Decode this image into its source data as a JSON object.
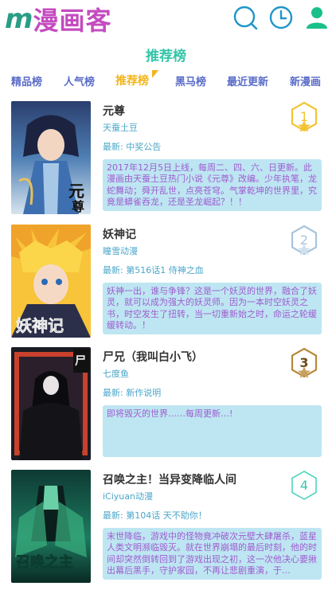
{
  "app": {
    "logo_m": "m",
    "logo_text": "漫画客"
  },
  "header": {
    "icons": [
      "search-icon",
      "clock-icon",
      "user-icon"
    ]
  },
  "section_title": "推荐榜",
  "tabs": [
    {
      "label": "精品榜",
      "active": false
    },
    {
      "label": "人气榜",
      "active": false
    },
    {
      "label": "推荐榜",
      "active": true
    },
    {
      "label": "黑马榜",
      "active": false
    },
    {
      "label": "最近更新",
      "active": false
    },
    {
      "label": "新漫画",
      "active": false
    }
  ],
  "latest_prefix": "最新: ",
  "items": [
    {
      "rank": "1",
      "title": "元尊",
      "author": "天蚕土豆",
      "latest": "中奖公告",
      "desc": "2017年12月5日上线，每周二、四、六、日更新。此漫画由天蚕土豆热门小说《元尊》改编。少年执笔，龙蛇舞动；舜开乱世，点亮苍穹。气掌乾坤的世界里，究竟是蟒雀吞龙，还是圣龙崛起？！！",
      "cover_text": "元尊",
      "rank_color": "#f2c432",
      "star_color": "#f2c432"
    },
    {
      "rank": "2",
      "title": "妖神记",
      "author": "瞳雪动漫",
      "latest": "第516话1 侍神之血",
      "desc": "妖神一出，谁与争锋？这是一个妖灵的世界，融合了妖灵，就可以成为强大的妖灵师。因为一本时空妖灵之书，时空发生了扭转，当一切重新始之时，命运之轮缓缓转动。！",
      "cover_text": "妖神记",
      "rank_color": "#a8c4dc",
      "star_color": "#cfe0ef"
    },
    {
      "rank": "3",
      "title": "尸兄（我叫白小飞）",
      "author": "七度鱼",
      "latest": "新作说明",
      "desc": "即将毁灭的世界……每周更新…!",
      "cover_text": "",
      "rank_color": "#b8893a",
      "star_color": "#c9a060"
    },
    {
      "rank": "4",
      "title": "召唤之主！当异变降临人间",
      "author": "iCiyuan动漫",
      "latest": "第104话 天不助你！",
      "desc": "末世降临，游戏中的怪物竟冲破次元壁大肆屠杀，蓝星人类文明濒临毁灭。就在世界崩塌的最后时刻，他的时间却突然倒转回到了游戏出现之初，这一次他决心要揪出幕后黑手，守护家园，不再让悲剧重演，于…",
      "cover_text": "召唤之主",
      "rank_color": "#4fd4c0",
      "star_color": ""
    }
  ]
}
